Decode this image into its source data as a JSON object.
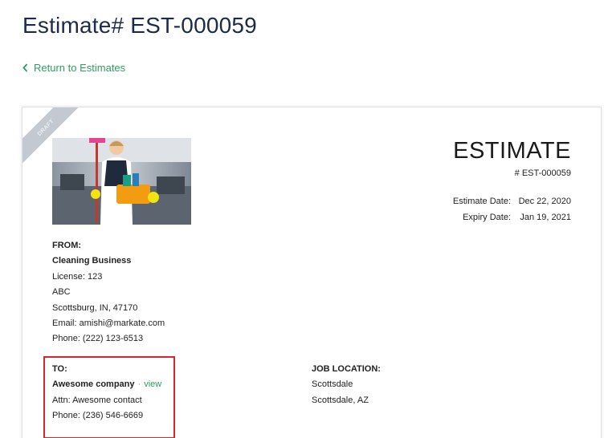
{
  "page": {
    "title": "Estimate# EST-000059",
    "back_link": "Return to Estimates"
  },
  "estimate": {
    "ribbon": "DRAFT",
    "heading": "ESTIMATE",
    "number": "# EST-000059",
    "dates": [
      {
        "label": "Estimate Date:",
        "value": "Dec 22, 2020"
      },
      {
        "label": "Expiry Date:",
        "value": "Jan 19, 2021"
      }
    ]
  },
  "from": {
    "label": "FROM:",
    "business": "Cleaning Business",
    "license": "License: 123",
    "line1": "ABC",
    "city": "Scottsburg, IN, 47170",
    "email": "Email: amishi@markate.com",
    "phone": "Phone: (222) 123-6513"
  },
  "to": {
    "label": "TO:",
    "company": "Awesome company",
    "separator": "·",
    "view_link": "view",
    "attn": "Attn: Awesome contact",
    "phone": "Phone: (236) 546-6669"
  },
  "job_location": {
    "label": "JOB LOCATION:",
    "line1": "Scottsdale",
    "line2": "Scottsdale, AZ"
  },
  "colors": {
    "accent": "#2e9e60",
    "title": "#1c2b4a",
    "highlight_border": "#d9262c",
    "ribbon": "#c4c9d1"
  }
}
